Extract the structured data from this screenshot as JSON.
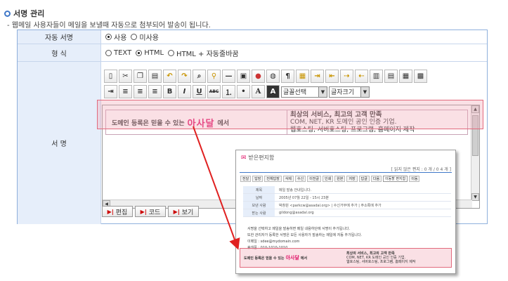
{
  "section": {
    "title": "서명 관리",
    "description": "- 웹메일 사용자들이 메일을 보낼때 자동으로 첨부되어 발송이 됩니다."
  },
  "auto_signature": {
    "label": "자동 서명",
    "options": [
      {
        "label": "사용",
        "selected": true
      },
      {
        "label": "미사용",
        "selected": false
      }
    ]
  },
  "format": {
    "label": "형 식",
    "options": [
      {
        "label": "TEXT",
        "selected": false
      },
      {
        "label": "HTML",
        "selected": true
      },
      {
        "label": "HTML + 자동줄바꿈",
        "selected": false
      }
    ]
  },
  "signature": {
    "label": "서 명",
    "toolbar": {
      "font_select": "글꼴선택",
      "size_select": "글자크기",
      "bold": "B",
      "italic": "I",
      "underline": "U",
      "strike": "ABC",
      "font_color": "A"
    },
    "content": {
      "left_text": "도메인 등록은 믿을 수 있는",
      "brand": "아사달",
      "suffix": "에서",
      "headline": "최상의 서비스, 최고의 고객 만족",
      "line1": "COM, NET, KR 도메인 공인 인증 기업.",
      "line2": "웹호스팅, 서버호스팅, 프로그램, 홈페이지 제작"
    },
    "mode_buttons": [
      {
        "label": "편집"
      },
      {
        "label": "코드"
      },
      {
        "label": "보기"
      }
    ]
  },
  "preview": {
    "title": "받은편지함",
    "count": "[ 읽지 않은 편지 : 0 개 / 0 4 개 ]",
    "toolbar": [
      "전달",
      "답장",
      "전체답장",
      "삭제",
      "수신",
      "이전글",
      "인쇄",
      "원본",
      "저장",
      "답글",
      "다음",
      "이동할 편지함",
      "이동"
    ],
    "rows": [
      {
        "k": "제목",
        "v": "메일 발송 안내입니다."
      },
      {
        "k": "날짜",
        "v": "2005년 07월 22일 - 15시 23분"
      },
      {
        "k": "보낸 사람",
        "v": "박창원 <parkcw@asadal.org> | 수신거부에 추가 | 주소록에 추가"
      },
      {
        "k": "받는 사람",
        "v": "gildong@asadal.org"
      }
    ],
    "body": [
      "서명을 선택하고 메일을 발송하면 메일 내용하단에 서명이 추가됩니다.",
      "",
      "또한 관리자가 등록한 서명은 모든 사용자가 발송하는 메일에 자동 추가됩니다.",
      "",
      "이메일 : sdee@mydomain.com",
      "휴대폰 : 010-1010-1010"
    ]
  },
  "colors": {
    "accent": "#3f78c8",
    "label_bg": "#e6eefa",
    "highlight": "#f1a5b4",
    "arrow": "#e02020",
    "brand": "#e0176a"
  }
}
